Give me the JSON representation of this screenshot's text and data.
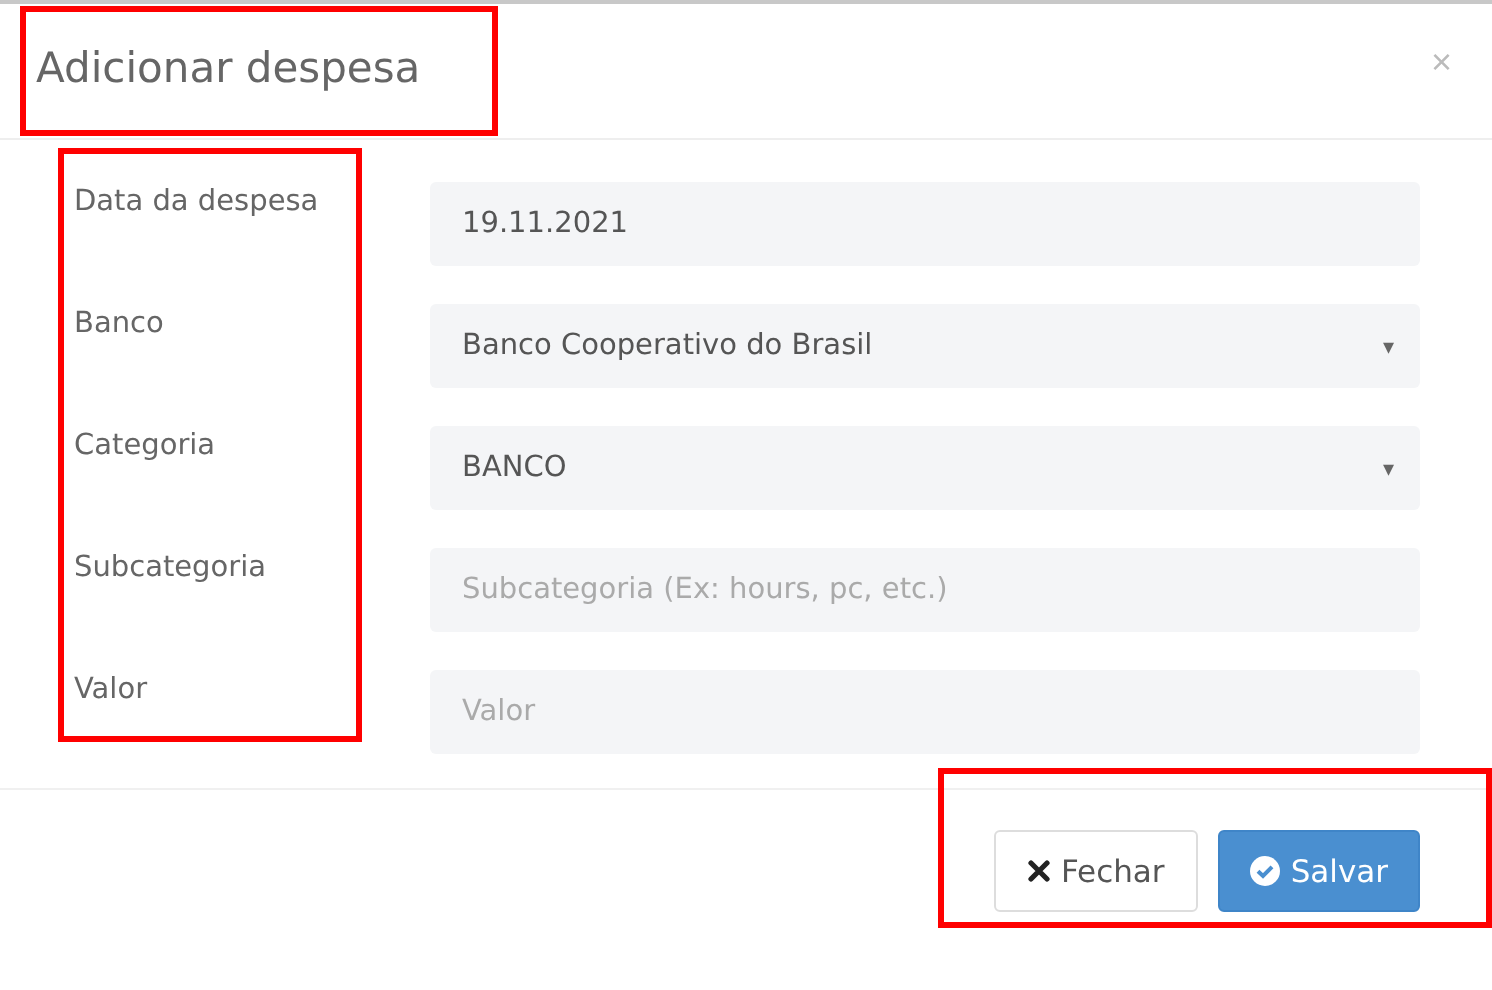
{
  "dialog": {
    "title": "Adicionar despesa",
    "title_highlighted": true,
    "close": "×"
  },
  "form": {
    "labels_highlighted": true,
    "fields": [
      {
        "label": "Data da despesa",
        "kind": "text",
        "value": "19.11.2021"
      },
      {
        "label": "Banco",
        "kind": "select",
        "value": "Banco Cooperativo do Brasil",
        "arrow": "▾"
      },
      {
        "label": "Categoria",
        "kind": "select",
        "value": "BANCO",
        "arrow": "▾"
      },
      {
        "label": "Subcategoria",
        "kind": "text",
        "placeholder": "Subcategoria (Ex: hours, pc, etc.)"
      },
      {
        "label": "Valor",
        "kind": "text",
        "placeholder": "Valor"
      }
    ]
  },
  "footer": {
    "highlighted": true,
    "buttons": [
      {
        "label": "Fechar",
        "kind": "default"
      },
      {
        "label": "Salvar",
        "kind": "primary"
      }
    ]
  }
}
